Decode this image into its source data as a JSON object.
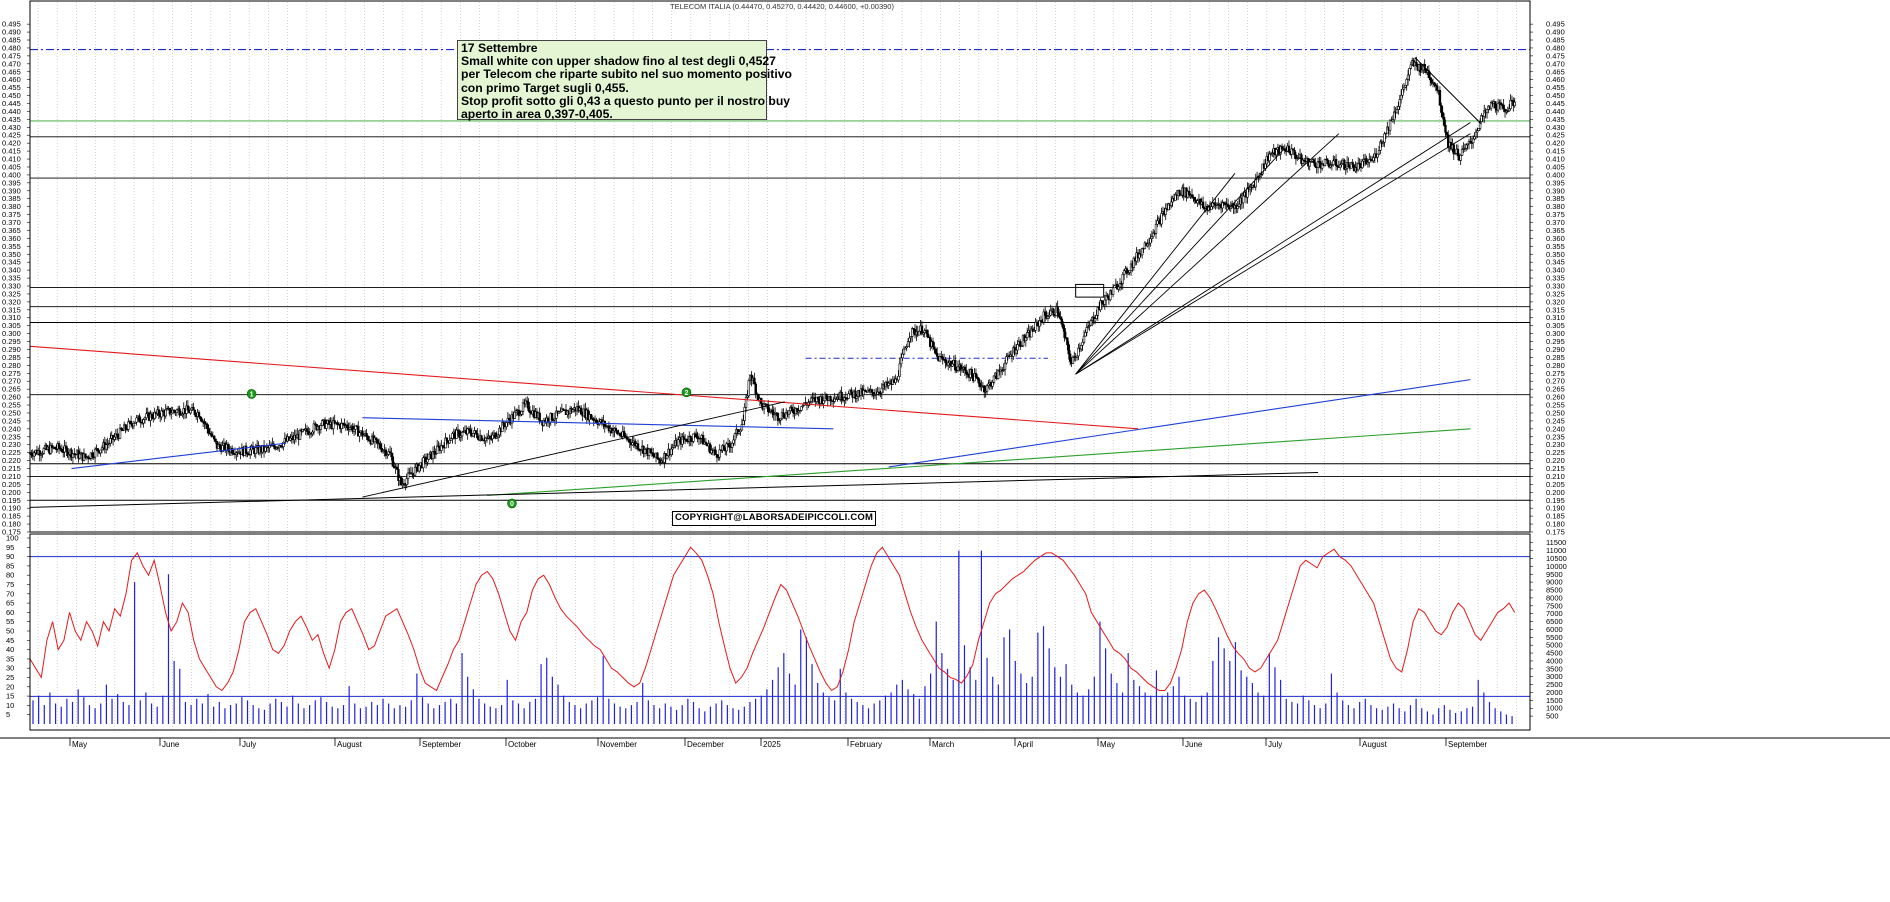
{
  "header": {
    "title": "TELECOM ITALIA (0.44470, 0.45270, 0.44420, 0.44600, +0.00390)"
  },
  "annotation": {
    "lines": [
      "17 Settembre",
      "Small white con upper shadow fino al test degli 0,4527",
      "per Telecom che riparte subito nel suo momento positivo",
      "con primo Target sugli 0,455.",
      "Stop profit sotto gli 0,43 a questo punto per il nostro buy",
      "aperto in area 0,397-0,405."
    ]
  },
  "copyright": "COPYRIGHT@LABORSADEIPICCOLI.COM",
  "colors": {
    "candles": "#000000",
    "trend_red": "#e41a1c",
    "trend_blue": "#1f3fd8",
    "trend_green": "#2ca02c",
    "oscillator": "#e41a1c",
    "volume": "#2222dd",
    "reference_dashed": "#1a2bd1",
    "reference_green": "#2ca02c",
    "marker_fill": "#1a9a1a"
  },
  "chart_data": [
    {
      "type": "candlestick",
      "title": "TELECOM ITALIA (0.44470, 0.45270, 0.44420, 0.44600, +0.00390)",
      "ylim": [
        0.175,
        0.5
      ],
      "y_ticks": [
        "0.175",
        "0.180",
        "0.185",
        "0.190",
        "0.195",
        "0.200",
        "0.205",
        "0.210",
        "0.215",
        "0.220",
        "0.225",
        "0.230",
        "0.235",
        "0.240",
        "0.245",
        "0.250",
        "0.255",
        "0.260",
        "0.265",
        "0.270",
        "0.275",
        "0.280",
        "0.285",
        "0.290",
        "0.295",
        "0.300",
        "0.305",
        "0.310",
        "0.315",
        "0.320",
        "0.325",
        "0.330",
        "0.335",
        "0.340",
        "0.345",
        "0.350",
        "0.355",
        "0.360",
        "0.365",
        "0.370",
        "0.375",
        "0.380",
        "0.385",
        "0.390",
        "0.395",
        "0.400",
        "0.405",
        "0.410",
        "0.415",
        "0.420",
        "0.425",
        "0.430",
        "0.435",
        "0.440",
        "0.445",
        "0.450",
        "0.455",
        "0.460",
        "0.465",
        "0.470",
        "0.475",
        "0.480",
        "0.485",
        "0.490",
        "0.495"
      ],
      "grid": true,
      "price_path": [
        [
          0,
          0.225
        ],
        [
          20,
          0.228
        ],
        [
          40,
          0.222
        ],
        [
          55,
          0.23
        ],
        [
          75,
          0.245
        ],
        [
          95,
          0.25
        ],
        [
          110,
          0.252
        ],
        [
          122,
          0.25
        ],
        [
          135,
          0.229
        ],
        [
          152,
          0.226
        ],
        [
          170,
          0.227
        ],
        [
          190,
          0.234
        ],
        [
          210,
          0.243
        ],
        [
          230,
          0.242
        ],
        [
          245,
          0.234
        ],
        [
          260,
          0.224
        ],
        [
          268,
          0.205
        ],
        [
          280,
          0.216
        ],
        [
          292,
          0.225
        ],
        [
          305,
          0.236
        ],
        [
          318,
          0.238
        ],
        [
          332,
          0.233
        ],
        [
          345,
          0.245
        ],
        [
          358,
          0.255
        ],
        [
          370,
          0.245
        ],
        [
          385,
          0.25
        ],
        [
          395,
          0.253
        ],
        [
          410,
          0.245
        ],
        [
          425,
          0.237
        ],
        [
          440,
          0.229
        ],
        [
          455,
          0.22
        ],
        [
          468,
          0.232
        ],
        [
          482,
          0.236
        ],
        [
          495,
          0.224
        ],
        [
          505,
          0.229
        ],
        [
          515,
          0.245
        ],
        [
          520,
          0.275
        ],
        [
          528,
          0.255
        ],
        [
          540,
          0.248
        ],
        [
          550,
          0.251
        ],
        [
          565,
          0.258
        ],
        [
          580,
          0.26
        ],
        [
          595,
          0.262
        ],
        [
          610,
          0.263
        ],
        [
          625,
          0.27
        ],
        [
          635,
          0.3
        ],
        [
          645,
          0.303
        ],
        [
          655,
          0.285
        ],
        [
          668,
          0.28
        ],
        [
          680,
          0.274
        ],
        [
          690,
          0.265
        ],
        [
          700,
          0.276
        ],
        [
          712,
          0.292
        ],
        [
          722,
          0.3
        ],
        [
          732,
          0.311
        ],
        [
          742,
          0.315
        ],
        [
          752,
          0.281
        ],
        [
          762,
          0.3
        ],
        [
          772,
          0.317
        ],
        [
          782,
          0.327
        ],
        [
          795,
          0.343
        ],
        [
          808,
          0.36
        ],
        [
          820,
          0.378
        ],
        [
          830,
          0.39
        ],
        [
          838,
          0.388
        ],
        [
          848,
          0.379
        ],
        [
          860,
          0.382
        ],
        [
          870,
          0.38
        ],
        [
          882,
          0.392
        ],
        [
          895,
          0.413
        ],
        [
          908,
          0.417
        ],
        [
          918,
          0.409
        ],
        [
          930,
          0.407
        ],
        [
          945,
          0.407
        ],
        [
          958,
          0.405
        ],
        [
          970,
          0.41
        ],
        [
          978,
          0.425
        ],
        [
          988,
          0.445
        ],
        [
          998,
          0.47
        ],
        [
          1008,
          0.466
        ],
        [
          1016,
          0.455
        ],
        [
          1024,
          0.42
        ],
        [
          1032,
          0.412
        ],
        [
          1040,
          0.42
        ],
        [
          1048,
          0.435
        ],
        [
          1056,
          0.445
        ],
        [
          1064,
          0.441
        ],
        [
          1072,
          0.446
        ]
      ],
      "markers": [
        {
          "label": "1",
          "x": 160,
          "price": 0.262
        },
        {
          "label": "2",
          "x": 474,
          "price": 0.263
        },
        {
          "label": "0",
          "x": 348,
          "price": 0.193
        }
      ],
      "support_resistance": [
        0.2615,
        0.218,
        0.21,
        0.195,
        0.307,
        0.317,
        0.329,
        0.398,
        0.424,
        0.434,
        0.479
      ],
      "trendlines": [
        {
          "color": "red",
          "from": [
            0,
            0.292
          ],
          "to": [
            800,
            0.24
          ]
        },
        {
          "color": "blue",
          "from": [
            240,
            0.247
          ],
          "to": [
            580,
            0.24
          ]
        },
        {
          "color": "blue",
          "from": [
            30,
            0.215
          ],
          "to": [
            185,
            0.231
          ]
        },
        {
          "color": "blue",
          "from": [
            620,
            0.216
          ],
          "to": [
            1040,
            0.271
          ]
        },
        {
          "color": "green",
          "from": [
            330,
            0.198
          ],
          "to": [
            1040,
            0.24
          ]
        }
      ],
      "x_labels": [
        "May",
        "June",
        "July",
        "August",
        "September",
        "October",
        "November",
        "December",
        "2025",
        "February",
        "March",
        "April",
        "May",
        "June",
        "July",
        "August",
        "September"
      ]
    },
    {
      "type": "line+bar",
      "left_ylim": [
        0,
        100
      ],
      "left_ticks": [
        "5",
        "10",
        "15",
        "20",
        "25",
        "30",
        "35",
        "40",
        "45",
        "50",
        "55",
        "60",
        "65",
        "70",
        "75",
        "80",
        "85",
        "90",
        "95",
        "100"
      ],
      "right_ticks": [
        "500",
        "1000",
        "1500",
        "2000",
        "2500",
        "3000",
        "3500",
        "4000",
        "4500",
        "5000",
        "5500",
        "6000",
        "6500",
        "7000",
        "7500",
        "8000",
        "8500",
        "9000",
        "9500",
        "10000",
        "10500",
        "11000",
        "11500"
      ],
      "reference_level": 90,
      "reference_volume": 1750,
      "oscillator": [
        35,
        30,
        25,
        45,
        55,
        40,
        45,
        60,
        50,
        45,
        55,
        50,
        42,
        55,
        50,
        62,
        58,
        70,
        88,
        92,
        85,
        80,
        88,
        75,
        60,
        50,
        55,
        65,
        60,
        45,
        35,
        30,
        25,
        20,
        18,
        22,
        28,
        40,
        55,
        60,
        62,
        55,
        48,
        40,
        38,
        42,
        50,
        55,
        58,
        52,
        45,
        48,
        38,
        30,
        40,
        55,
        60,
        62,
        55,
        48,
        40,
        42,
        50,
        58,
        60,
        62,
        55,
        48,
        40,
        30,
        22,
        20,
        18,
        25,
        32,
        40,
        45,
        55,
        65,
        75,
        80,
        82,
        78,
        70,
        60,
        50,
        45,
        55,
        60,
        72,
        78,
        80,
        75,
        68,
        62,
        58,
        55,
        52,
        48,
        45,
        42,
        40,
        35,
        30,
        28,
        25,
        22,
        20,
        22,
        30,
        40,
        50,
        60,
        70,
        80,
        85,
        90,
        95,
        92,
        88,
        80,
        70,
        55,
        42,
        30,
        22,
        25,
        30,
        38,
        45,
        52,
        60,
        68,
        75,
        72,
        65,
        58,
        50,
        42,
        35,
        28,
        22,
        18,
        20,
        28,
        40,
        55,
        65,
        75,
        85,
        92,
        95,
        90,
        85,
        80,
        70,
        60,
        52,
        45,
        40,
        35,
        30,
        28,
        25,
        24,
        22,
        26,
        32,
        45,
        55,
        65,
        70,
        72,
        75,
        78,
        80,
        82,
        85,
        88,
        90,
        92,
        92,
        90,
        88,
        84,
        80,
        75,
        70,
        60,
        55,
        50,
        45,
        40,
        38,
        35,
        30,
        28,
        25,
        22,
        20,
        18,
        18,
        22,
        30,
        40,
        55,
        65,
        70,
        72,
        68,
        62,
        55,
        48,
        42,
        38,
        35,
        30,
        28,
        30,
        35,
        40,
        45,
        55,
        65,
        75,
        85,
        88,
        86,
        84,
        90,
        92,
        94,
        90,
        88,
        85,
        80,
        75,
        70,
        65,
        55,
        45,
        35,
        30,
        28,
        40,
        55,
        62,
        60,
        55,
        50,
        48,
        52,
        60,
        65,
        62,
        55,
        48,
        45,
        50,
        55,
        60,
        62,
        65,
        60
      ],
      "volume_k": [
        1.5,
        1.8,
        1.2,
        2.0,
        1.3,
        1.1,
        1.6,
        1.4,
        2.2,
        1.7,
        1.2,
        1.0,
        1.3,
        2.5,
        1.6,
        1.9,
        1.4,
        1.2,
        9.0,
        1.5,
        2.0,
        1.3,
        1.1,
        1.8,
        9.5,
        4.0,
        3.5,
        1.4,
        1.2,
        1.6,
        1.3,
        1.9,
        1.1,
        1.4,
        1.0,
        1.2,
        1.3,
        1.7,
        1.5,
        1.2,
        1.0,
        0.9,
        1.3,
        1.6,
        1.4,
        1.1,
        1.8,
        1.3,
        1.0,
        1.2,
        1.5,
        1.7,
        1.4,
        1.1,
        1.0,
        1.2,
        2.4,
        1.3,
        1.0,
        1.1,
        1.4,
        1.2,
        1.6,
        1.3,
        1.0,
        1.2,
        1.1,
        1.5,
        3.2,
        1.7,
        1.3,
        1.0,
        1.2,
        1.4,
        1.6,
        1.3,
        4.5,
        3.0,
        2.2,
        1.6,
        1.3,
        1.1,
        1.0,
        1.2,
        2.8,
        1.5,
        1.3,
        1.0,
        1.4,
        1.6,
        3.8,
        4.2,
        3.0,
        2.5,
        1.8,
        1.4,
        1.2,
        1.0,
        1.3,
        1.5,
        1.7,
        4.3,
        1.6,
        1.3,
        1.1,
        1.0,
        1.2,
        1.4,
        2.6,
        1.5,
        1.2,
        1.0,
        1.3,
        1.1,
        0.9,
        1.2,
        1.6,
        1.4,
        1.0,
        0.8,
        1.1,
        1.3,
        1.5,
        1.2,
        1.0,
        0.9,
        1.1,
        1.4,
        1.6,
        1.8,
        2.2,
        2.8,
        3.6,
        4.5,
        3.2,
        2.5,
        6.0,
        5.5,
        3.8,
        2.6,
        2.0,
        1.7,
        1.5,
        3.5,
        2.0,
        1.6,
        1.4,
        1.2,
        1.0,
        1.3,
        1.5,
        1.8,
        2.0,
        2.5,
        2.8,
        2.2,
        1.9,
        1.6,
        2.4,
        3.2,
        6.5,
        4.5,
        3.5,
        2.8,
        11.0,
        5.0,
        3.6,
        2.8,
        11.0,
        4.2,
        3.0,
        2.5,
        5.5,
        6.0,
        4.0,
        3.2,
        2.6,
        3.0,
        5.8,
        6.2,
        4.8,
        3.6,
        3.0,
        3.8,
        2.5,
        2.0,
        1.8,
        2.2,
        3.0,
        6.5,
        4.8,
        3.2,
        2.6,
        2.0,
        4.5,
        2.8,
        2.4,
        2.0,
        1.8,
        3.4,
        1.8,
        2.0,
        2.4,
        3.0,
        1.8,
        1.6,
        1.4,
        1.8,
        2.0,
        4.0,
        5.5,
        4.8,
        4.0,
        5.2,
        3.4,
        3.0,
        2.6,
        2.0,
        1.8,
        4.5,
        3.6,
        2.8,
        1.6,
        1.4,
        1.3,
        1.8,
        1.5,
        1.2,
        1.0,
        1.3,
        3.2,
        2.0,
        1.5,
        1.2,
        1.0,
        1.4,
        1.6,
        1.2,
        1.0,
        0.9,
        1.1,
        1.3,
        1.0,
        0.8,
        1.2,
        1.6,
        1.0,
        0.8,
        0.6,
        1.0,
        1.2,
        0.9,
        0.7,
        0.8,
        1.0,
        1.1,
        2.8,
        2.0,
        1.4,
        1.0,
        0.8,
        0.6,
        0.5
      ]
    }
  ]
}
